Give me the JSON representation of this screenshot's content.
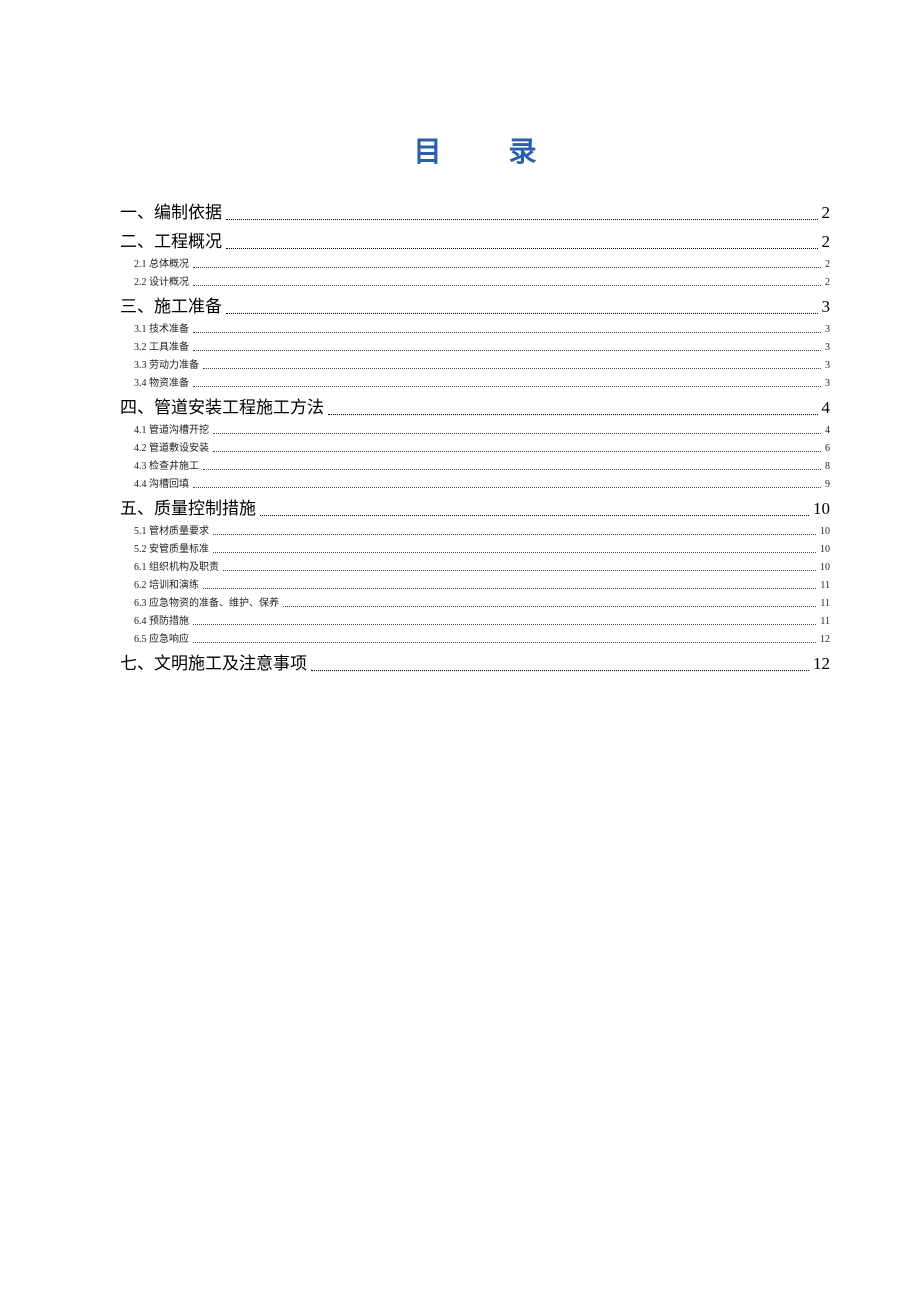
{
  "title": "目  录",
  "toc": [
    {
      "level": 1,
      "label": "一、编制依据",
      "page": "2"
    },
    {
      "level": 1,
      "label": "二、工程概况",
      "page": "2"
    },
    {
      "level": 2,
      "label": "2.1 总体概况",
      "page": "2"
    },
    {
      "level": 2,
      "label": "2.2  设计概况",
      "page": "2"
    },
    {
      "level": 1,
      "label": "三、施工准备",
      "page": "3"
    },
    {
      "level": 2,
      "label": "3.1 技术准备",
      "page": "3"
    },
    {
      "level": 2,
      "label": "3.2 工具准备",
      "page": "3"
    },
    {
      "level": 2,
      "label": "3.3 劳动力准备",
      "page": "3"
    },
    {
      "level": 2,
      "label": "3.4 物资准备",
      "page": "3"
    },
    {
      "level": 1,
      "label": "四、管道安装工程施工方法",
      "page": "4"
    },
    {
      "level": 2,
      "label": "4.1 管道沟槽开挖",
      "page": "4"
    },
    {
      "level": 2,
      "label": "4.2 管道敷设安装",
      "page": "6"
    },
    {
      "level": 2,
      "label": "4.3 检查井施工",
      "page": "8"
    },
    {
      "level": 2,
      "label": "4.4 沟槽回填",
      "page": "9"
    },
    {
      "level": 1,
      "label": "五、质量控制措施",
      "page": "10"
    },
    {
      "level": 2,
      "label": "5.1  管材质量要求",
      "page": "10"
    },
    {
      "level": 2,
      "label": "5.2  安管质量标准",
      "page": "10"
    },
    {
      "level": 2,
      "label": "6.1 组织机构及职责",
      "page": "10"
    },
    {
      "level": 2,
      "label": "6.2  培训和演练",
      "page": "11"
    },
    {
      "level": 2,
      "label": "6.3  应急物资的准备、维护、保养",
      "page": "11"
    },
    {
      "level": 2,
      "label": "6.4  预防措施",
      "page": "11"
    },
    {
      "level": 2,
      "label": "6.5  应急响应",
      "page": "12"
    },
    {
      "level": 1,
      "label": "七、文明施工及注意事项",
      "page": "12"
    }
  ]
}
